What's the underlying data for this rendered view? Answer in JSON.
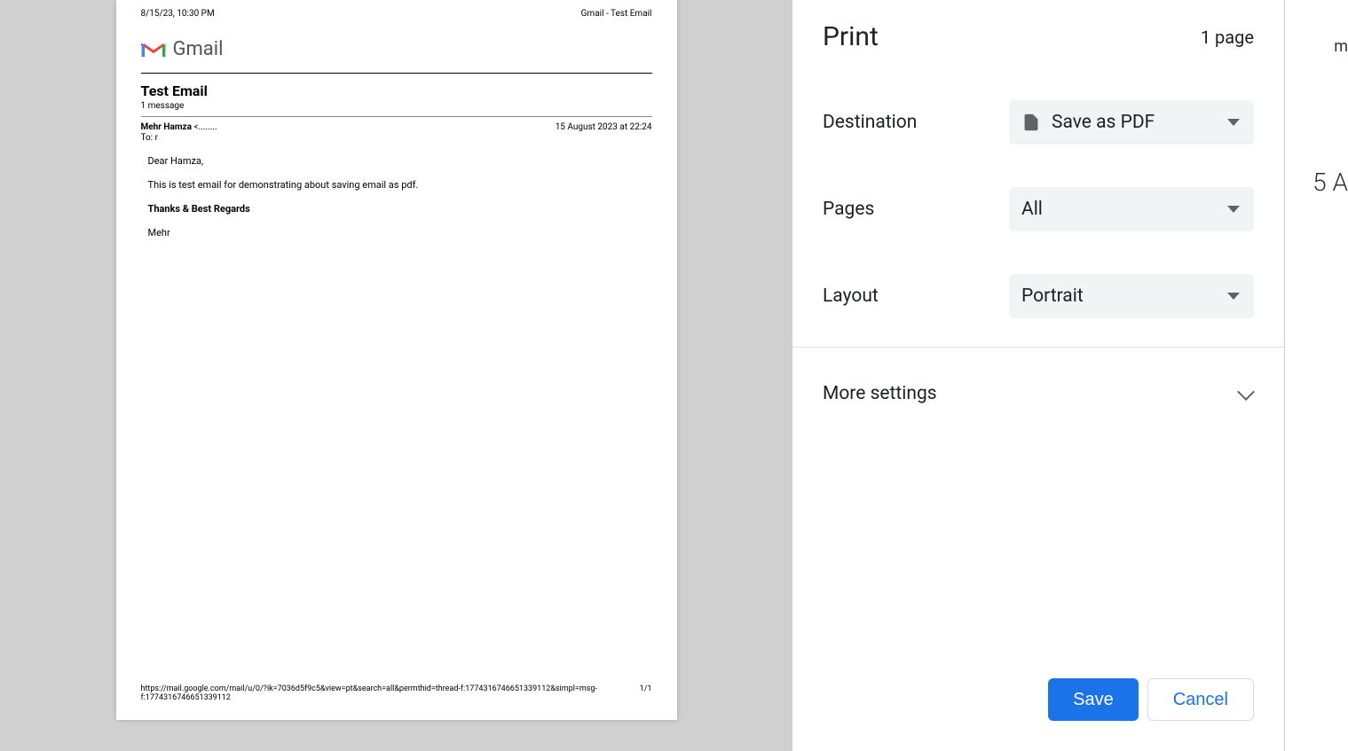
{
  "preview": {
    "header_left": "8/15/23, 10:30 PM",
    "header_right": "Gmail - Test Email",
    "gmail_text": "Gmail",
    "subject": "Test Email",
    "msg_count": "1 message",
    "sender_name": "Mehr Hamza",
    "sender_extra": " <........",
    "timestamp": "15 August 2023 at 22:24",
    "to_line": "To: r",
    "body": {
      "greeting": "Dear Hamza,",
      "line1": "This is test email for demonstrating about saving email as pdf.",
      "signoff": "Thanks & Best Regards",
      "signature": "Mehr"
    },
    "footer_url": "https://mail.google.com/mail/u/0/?ik=7036d5f9c5&view=pt&search=all&permthid=thread-f:1774316746651339112&simpl=msg-f:1774316746651339112",
    "footer_page": "1/1"
  },
  "strip": {
    "frag1": "m",
    "frag2": "5 A"
  },
  "print": {
    "title": "Print",
    "page_count": "1 page",
    "destination": {
      "label": "Destination",
      "value": "Save as PDF"
    },
    "pages": {
      "label": "Pages",
      "value": "All"
    },
    "layout": {
      "label": "Layout",
      "value": "Portrait"
    },
    "more_settings": "More settings",
    "save": "Save",
    "cancel": "Cancel"
  }
}
